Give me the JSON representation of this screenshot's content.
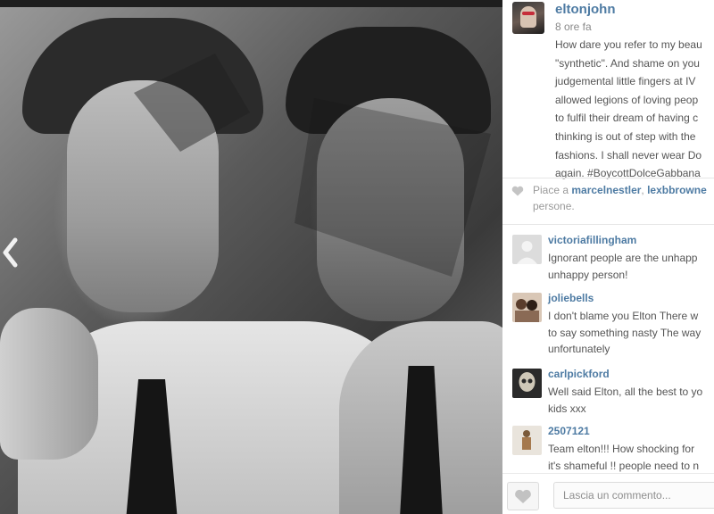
{
  "post": {
    "owner": "eltonjohn",
    "time": "8 ore fa",
    "caption_lines": [
      "How dare you refer to my beau",
      "\"synthetic\". And shame on you",
      "judgemental little fingers at IV",
      "allowed legions of loving peop",
      "to fulfil their dream of having c",
      "thinking is out of step with the",
      "fashions. I shall never wear Do",
      "again. #BoycottDolceGabbana"
    ]
  },
  "likes": {
    "prefix": "Piace a ",
    "user1": "marcelnestler",
    "separator": ", ",
    "user2": "lexbbrowne",
    "line2": "persone."
  },
  "comments": [
    {
      "user": "victoriafillingham",
      "lines": [
        "Ignorant people are the unhapp",
        "unhappy person!"
      ]
    },
    {
      "user": "joliebells",
      "lines": [
        "I don't blame you Elton There w",
        "to say something nasty The way",
        "unfortunately"
      ]
    },
    {
      "user": "carlpickford",
      "lines": [
        "Well said Elton, all the best to yo",
        "kids xxx"
      ]
    },
    {
      "user": "2507121",
      "lines": [
        "Team elton!!! How shocking for",
        "it's shameful !! people need to n"
      ]
    }
  ],
  "comment_box": {
    "placeholder": "Lascia un commento..."
  },
  "icons": {
    "nav_left": "chevron-left-icon",
    "heart": "heart-icon"
  },
  "colors": {
    "username": "#4e7ba3",
    "text": "#555555",
    "muted": "#9a9a9a"
  }
}
